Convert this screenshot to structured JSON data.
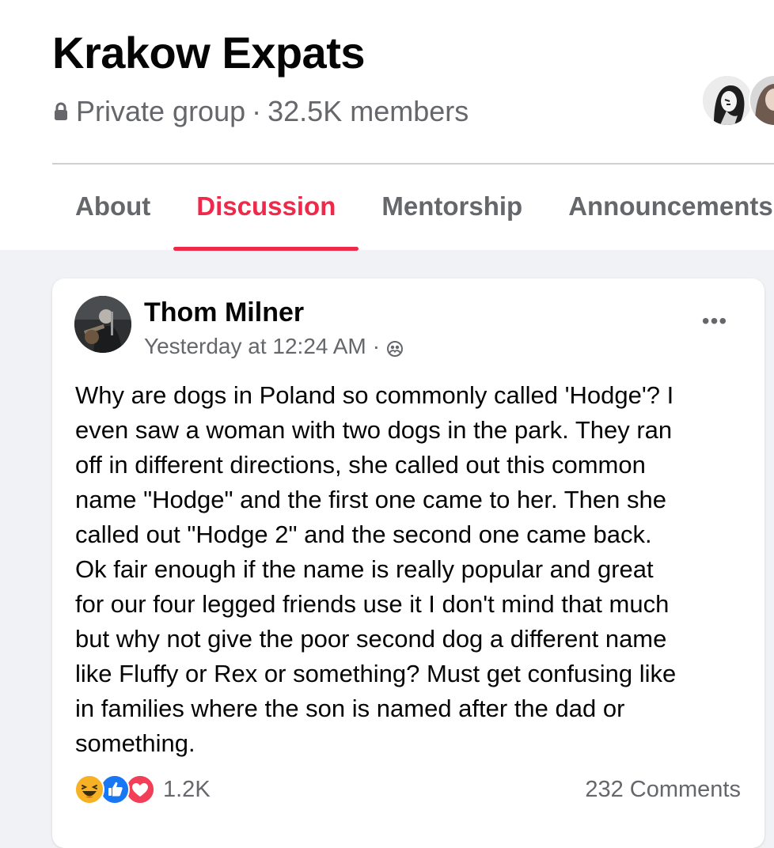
{
  "group": {
    "title": "Krakow Expats",
    "privacy": "Private group",
    "separator": "·",
    "members": "32.5K members"
  },
  "tabs": [
    {
      "label": "About",
      "active": false
    },
    {
      "label": "Discussion",
      "active": true
    },
    {
      "label": "Mentorship",
      "active": false
    },
    {
      "label": "Announcements",
      "active": false
    }
  ],
  "post": {
    "author": "Thom Milner",
    "time": "Yesterday at 12:24 AM",
    "time_separator": "·",
    "audience_icon": "members-icon",
    "more_icon": "more-options-icon",
    "more_label": "•••",
    "body": "Why are dogs in Poland so commonly called 'Hodge'? I\neven saw a woman with two dogs in the park. They ran\noff in different directions, she called out this common\nname \"Hodge\" and the first one came to her. Then she\ncalled out \"Hodge 2\" and the second one came back.\nOk fair enough if the name is really popular and great\nfor our four legged friends use it I don't mind that much\nbut why not give the poor second dog a different name\nlike Fluffy or Rex or something? Must get confusing like\nin families where the son is named after the dad or\nsomething.",
    "reactions": {
      "types": [
        "haha",
        "like",
        "love"
      ],
      "count": "1.2K"
    },
    "comments": "232 Comments"
  },
  "colors": {
    "accent": "#f02849",
    "secondary_text": "#65676b",
    "page_bg": "#f0f2f5",
    "like_blue": "#1877f2",
    "love_red": "#f33e58",
    "haha_yellow": "#f7b125"
  }
}
